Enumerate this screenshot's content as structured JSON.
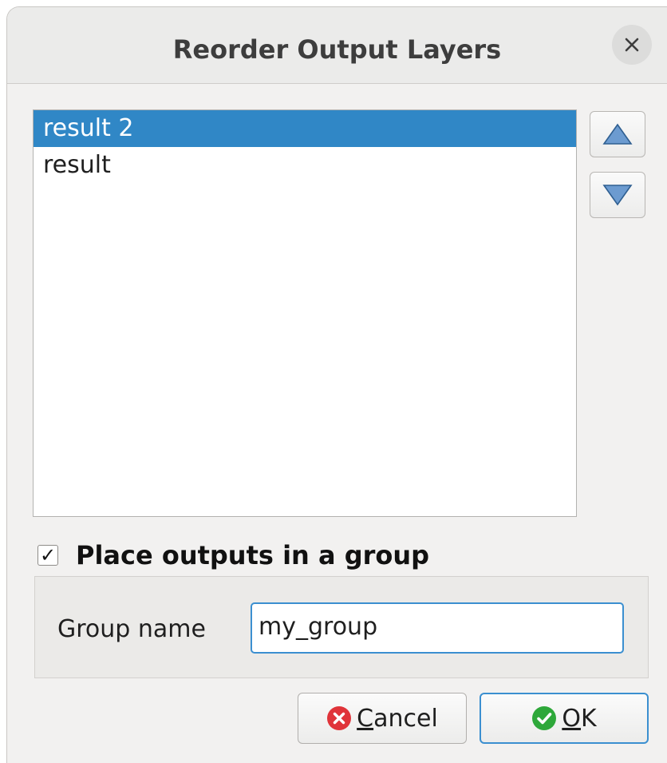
{
  "window": {
    "title": "Reorder Output Layers",
    "close_icon": "close-icon"
  },
  "layers_list": {
    "items": [
      {
        "label": "result 2",
        "selected": true
      },
      {
        "label": "result",
        "selected": false
      }
    ]
  },
  "move_buttons": {
    "up_icon": "triangle-up-icon",
    "down_icon": "triangle-down-icon"
  },
  "group_option": {
    "checkbox_checked": true,
    "check_glyph": "✓",
    "label": "Place outputs in a group"
  },
  "group_name": {
    "label": "Group name",
    "value": "my_group"
  },
  "buttons": {
    "cancel": {
      "mnemonic": "C",
      "rest": "ancel",
      "icon": "cancel-icon",
      "icon_color": "#e0343a"
    },
    "ok": {
      "mnemonic": "O",
      "rest": "K",
      "icon": "check-circle-icon",
      "icon_color": "#2ea83a"
    }
  },
  "colors": {
    "selection": "#3087c6",
    "focus_border": "#3b8fd0",
    "arrow_fill": "#5a8fc4"
  }
}
